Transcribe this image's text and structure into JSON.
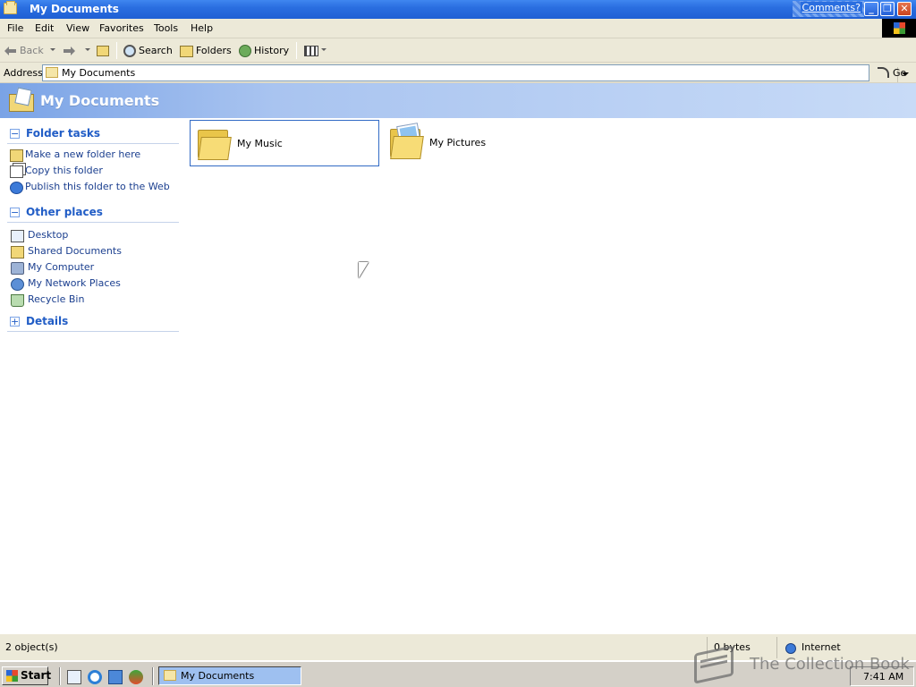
{
  "window": {
    "title": "My Documents",
    "comments_link": "Comments?",
    "min_glyph": "_",
    "max_glyph": "❐",
    "close_glyph": "✕"
  },
  "menu": {
    "items": [
      {
        "label": "File"
      },
      {
        "label": "Edit"
      },
      {
        "label": "View"
      },
      {
        "label": "Favorites"
      },
      {
        "label": "Tools"
      },
      {
        "label": "Help"
      }
    ]
  },
  "toolbar": {
    "back_label": "Back",
    "search_label": "Search",
    "folders_label": "Folders",
    "history_label": "History"
  },
  "address": {
    "label": "Address",
    "value": "My Documents",
    "go_label": "Go"
  },
  "header": {
    "title": "My Documents"
  },
  "taskpane": {
    "folder_tasks": {
      "title": "Folder tasks",
      "toggle": "−",
      "items": [
        {
          "label": "Make a new folder here",
          "icon": "new-folder-icon"
        },
        {
          "label": "Copy this folder",
          "icon": "copy-folder-icon"
        },
        {
          "label": "Publish this folder to the Web",
          "icon": "publish-web-icon"
        }
      ]
    },
    "other_places": {
      "title": "Other places",
      "toggle": "−",
      "items": [
        {
          "label": "Desktop",
          "icon": "desktop-icon"
        },
        {
          "label": "Shared Documents",
          "icon": "shared-documents-icon"
        },
        {
          "label": "My Computer",
          "icon": "my-computer-icon"
        },
        {
          "label": "My Network Places",
          "icon": "network-places-icon"
        },
        {
          "label": "Recycle Bin",
          "icon": "recycle-bin-icon"
        }
      ]
    },
    "details": {
      "title": "Details",
      "toggle": "+"
    }
  },
  "files": [
    {
      "name": "My Music",
      "selected": true
    },
    {
      "name": "My Pictures",
      "selected": false
    }
  ],
  "status": {
    "objects": "2 object(s)",
    "size": "0 bytes",
    "zone": "Internet"
  },
  "taskbar": {
    "start_label": "Start",
    "task_label": "My Documents",
    "clock": "7:41 AM"
  },
  "watermark": {
    "text": "The Collection Book"
  },
  "colors": {
    "titlebar": "#2a6ee0",
    "header_band": "#a9c4f0",
    "link": "#1b3f8f",
    "section_title": "#215dc6",
    "selection": "#316ac5"
  }
}
